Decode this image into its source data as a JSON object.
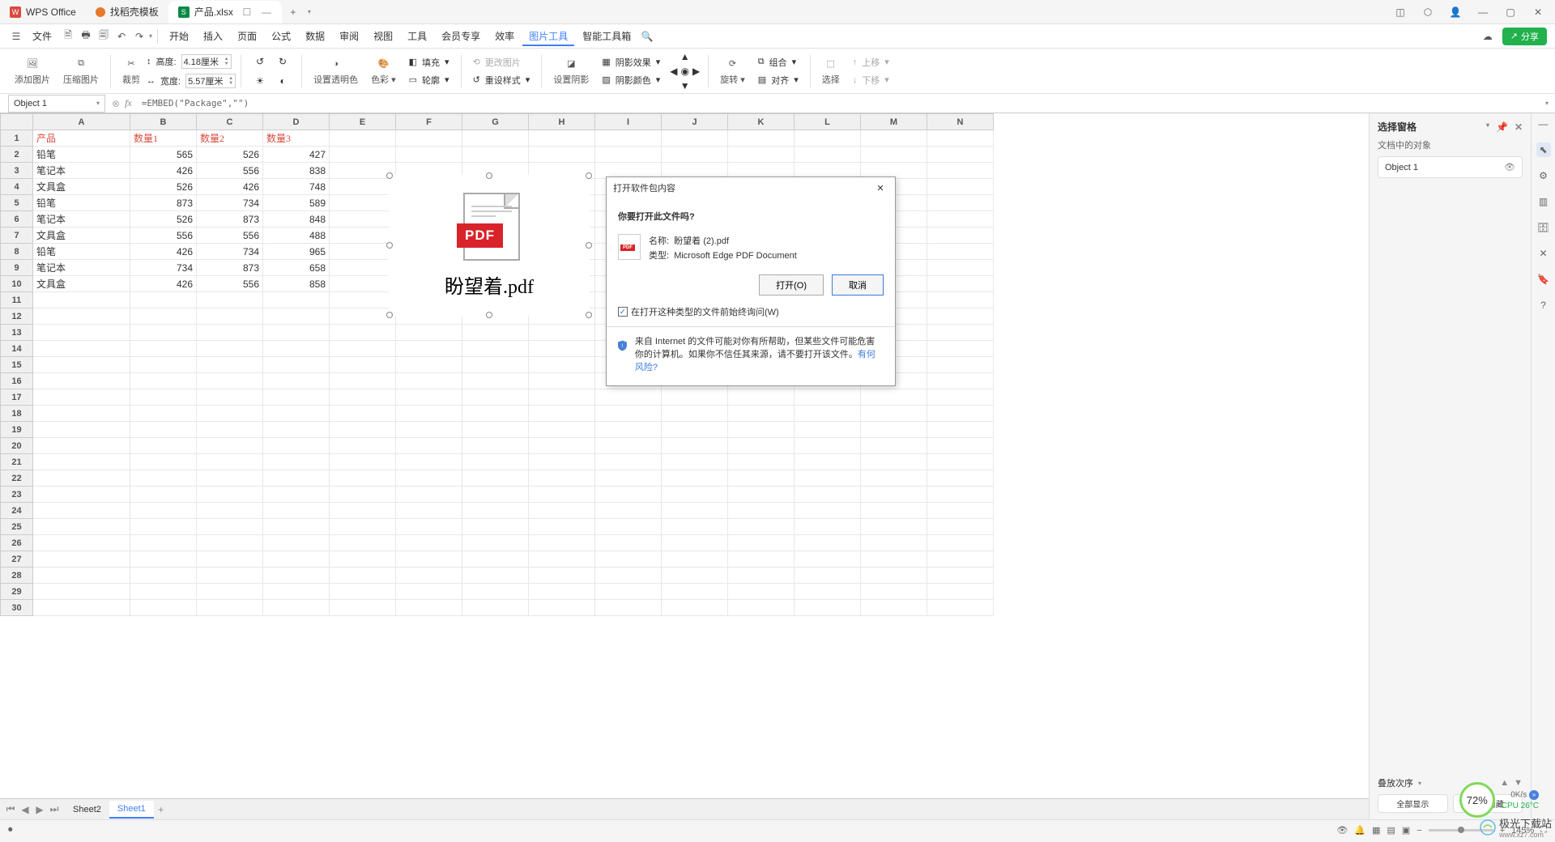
{
  "titlebar": {
    "app": "WPS Office",
    "tabs": [
      {
        "icon": "orange",
        "label": "找稻壳模板"
      },
      {
        "icon": "green",
        "label": "产品.xlsx",
        "active": true
      }
    ]
  },
  "menubar": {
    "file": "文件",
    "items": [
      "开始",
      "插入",
      "页面",
      "公式",
      "数据",
      "审阅",
      "视图",
      "工具",
      "会员专享",
      "效率",
      "图片工具",
      "智能工具箱"
    ],
    "active": "图片工具",
    "share": "分享"
  },
  "ribbon": {
    "add_image": "添加图片",
    "compress": "压缩图片",
    "crop": "裁剪",
    "height": "高度:",
    "height_val": "4.18厘米",
    "width": "宽度:",
    "width_val": "5.57厘米",
    "opacity": "设置透明色",
    "color": "色彩",
    "fill": "填充",
    "outline": "轮廓",
    "change": "更改图片",
    "reset": "重设样式",
    "shadow": "设置阴影",
    "shadow_effect": "阴影效果",
    "shadow_color": "阴影颜色",
    "rotate": "旋转",
    "group": "组合",
    "align": "对齐",
    "select": "选择",
    "up": "上移",
    "down": "下移"
  },
  "formula": {
    "name": "Object 1",
    "formula": "=EMBED(\"Package\",\"\")"
  },
  "sheet": {
    "cols": [
      "A",
      "B",
      "C",
      "D",
      "E",
      "F",
      "G",
      "H",
      "I",
      "J",
      "K",
      "L",
      "M",
      "N"
    ],
    "headers": [
      "产品",
      "数量1",
      "数量2",
      "数量3"
    ],
    "rows": [
      [
        "铅笔",
        "565",
        "526",
        "427"
      ],
      [
        "笔记本",
        "426",
        "556",
        "838"
      ],
      [
        "文具盒",
        "526",
        "426",
        "748"
      ],
      [
        "铅笔",
        "873",
        "734",
        "589"
      ],
      [
        "笔记本",
        "526",
        "873",
        "848"
      ],
      [
        "文具盒",
        "556",
        "556",
        "488"
      ],
      [
        "铅笔",
        "426",
        "734",
        "965"
      ],
      [
        "笔记本",
        "734",
        "873",
        "658"
      ],
      [
        "文具盒",
        "426",
        "556",
        "858"
      ]
    ]
  },
  "embed": {
    "label": "盼望着.pdf"
  },
  "dialog": {
    "title": "打开软件包内容",
    "question": "你要打开此文件吗?",
    "name_label": "名称:",
    "name_val": "盼望着 (2).pdf",
    "type_label": "类型:",
    "type_val": "Microsoft Edge PDF Document",
    "open": "打开(O)",
    "cancel": "取消",
    "checkbox": "在打开这种类型的文件前始终询问(W)",
    "warn": "来自 Internet 的文件可能对你有所帮助，但某些文件可能危害你的计算机。如果你不信任其来源，请不要打开该文件。",
    "risk": "有何风险?"
  },
  "side": {
    "title": "选择窗格",
    "subtitle": "文档中的对象",
    "item": "Object 1",
    "stack": "叠放次序",
    "show_all": "全部显示",
    "hide_all": "全部隐藏"
  },
  "sheettabs": {
    "tabs": [
      "Sheet2",
      "Sheet1"
    ],
    "active": "Sheet1"
  },
  "status": {
    "zoom": "145%",
    "cpu": "CPU 26°C",
    "net": "0K/s",
    "perf": "72%"
  },
  "watermark": {
    "name": "极光下载站",
    "url": "www.xz7.com"
  }
}
